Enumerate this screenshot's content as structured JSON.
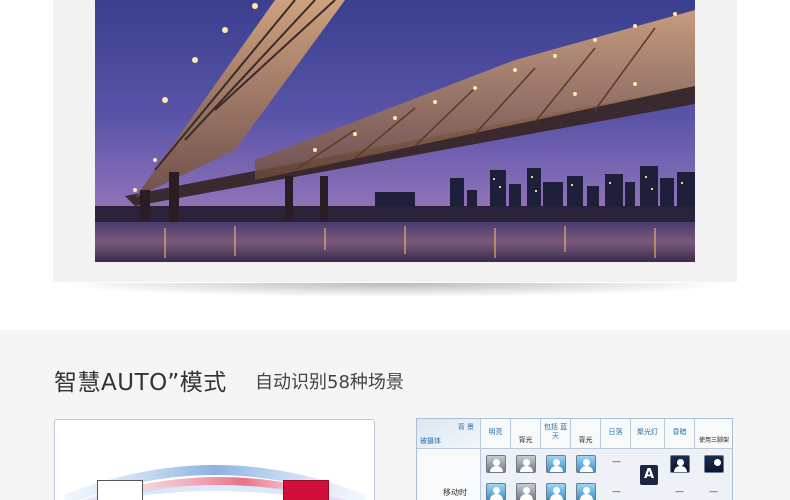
{
  "section": {
    "title": "智慧AUTO”模式",
    "subtitle": "自动识别58种场景"
  },
  "scene_table": {
    "corner_top": "背 景",
    "corner_bottom": "被摄体",
    "columns": [
      {
        "label": "明亮"
      },
      {
        "label": "背光"
      },
      {
        "label": "包括 蓝天"
      },
      {
        "label": "背光"
      },
      {
        "label": "日落"
      },
      {
        "label": "聚光灯"
      },
      {
        "label": "昏暗"
      },
      {
        "label": "使用三脚架"
      }
    ],
    "row_label": "移动时",
    "dash": "—"
  },
  "colors": {
    "section_bg": "#f5f5f5",
    "table_header_text": "#2a6fb0",
    "card_border": "#c9c3dc",
    "accent_red": "#d0103a"
  }
}
